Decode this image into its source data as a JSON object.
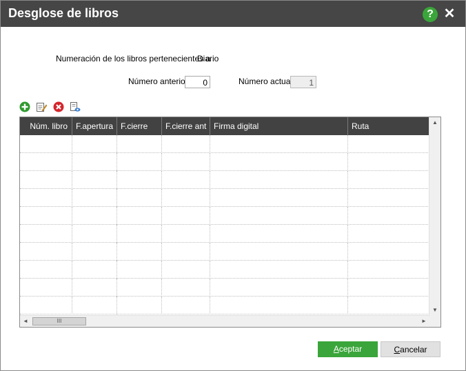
{
  "window": {
    "title": "Desglose de libros",
    "help_label": "?",
    "close_label": "✕"
  },
  "info": {
    "prefix": "Numeración de los libros pertenecientes a",
    "book": "Diario"
  },
  "fields": {
    "previous_label": "Número anterior",
    "previous_value": "0",
    "current_label": "Número actual",
    "current_value": "1"
  },
  "toolbar": [
    "add-icon",
    "edit-icon",
    "delete-icon",
    "preview-icon"
  ],
  "grid": {
    "columns": [
      "Núm. libro",
      "F.apertura",
      "F.cierre",
      "F.cierre ant",
      "Firma digital",
      "Ruta"
    ],
    "rows": []
  },
  "scroll": {
    "up": "▲",
    "down": "▼",
    "left": "◄",
    "right": "►",
    "thumb": "III"
  },
  "buttons": {
    "accept_first": "A",
    "accept_rest": "ceptar",
    "cancel_first": "C",
    "cancel_rest": "ancelar"
  },
  "colors": {
    "titlebar": "#464646",
    "accent": "#3aa53a",
    "grid_header": "#424242"
  }
}
